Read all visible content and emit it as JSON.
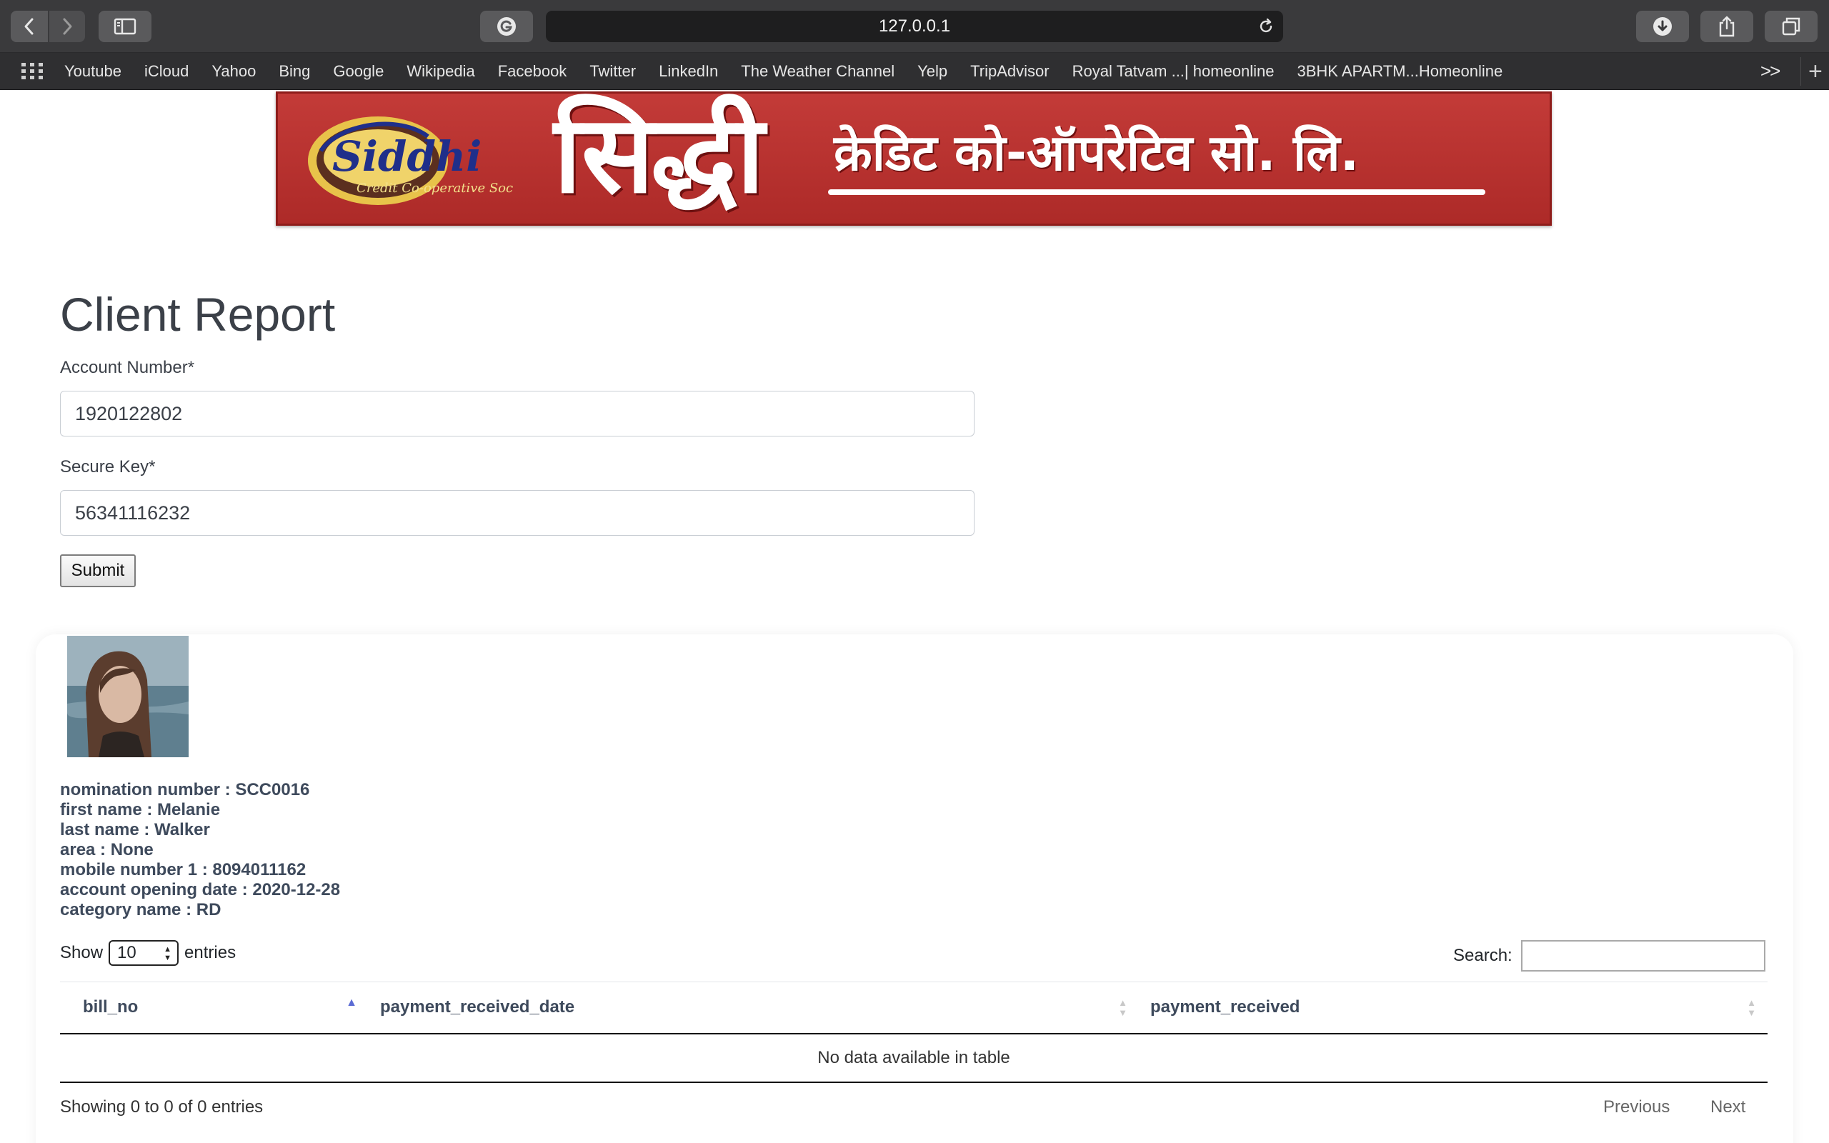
{
  "browser": {
    "url": "127.0.0.1",
    "bookmarks": [
      "Youtube",
      "iCloud",
      "Yahoo",
      "Bing",
      "Google",
      "Wikipedia",
      "Facebook",
      "Twitter",
      "LinkedIn",
      "The Weather Channel",
      "Yelp",
      "TripAdvisor",
      "Royal Tatvam ...| homeonline",
      "3BHK APARTM...Homeonline"
    ],
    "more": ">>",
    "new_tab": "+"
  },
  "banner": {
    "logo_text": "Siddhi",
    "logo_subtext": "Credit Co-operative Society Ltd.",
    "title_big": "सिद्धी",
    "title_small": "क्रेडिट को-ऑपरेटिव सो. लि.",
    "colors": {
      "background": "#b83230",
      "text": "#ffffff",
      "logo_gold": "#e8c34a"
    }
  },
  "form": {
    "title": "Client Report",
    "account_label": "Account Number*",
    "account_value": "1920122802",
    "secure_label": "Secure Key*",
    "secure_value": "56341116232",
    "submit_label": "Submit"
  },
  "client": {
    "details": [
      "nomination number : SCC0016",
      "first name : Melanie",
      "last name : Walker",
      "area : None",
      "mobile number 1 : 8094011162",
      "account opening date : 2020-12-28",
      "category name : RD"
    ]
  },
  "table": {
    "show_label": "Show",
    "length_value": "10",
    "entries_label": "entries",
    "search_label": "Search:",
    "columns": [
      "bill_no",
      "payment_received_date",
      "payment_received"
    ],
    "empty_message": "No data available in table",
    "info": "Showing 0 to 0 of 0 entries",
    "previous": "Previous",
    "next": "Next"
  }
}
